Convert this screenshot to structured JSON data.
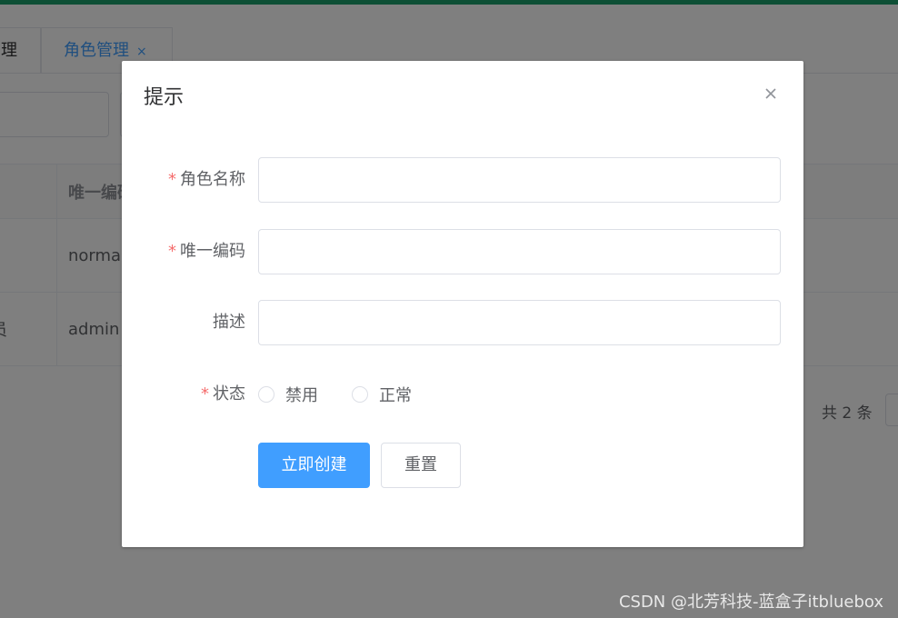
{
  "background": {
    "tabs": [
      {
        "label": "理"
      },
      {
        "label": "角色管理",
        "close": "×"
      }
    ],
    "table": {
      "header": [
        "",
        "唯一编码"
      ],
      "rows": [
        [
          "",
          "normal"
        ],
        [
          "员",
          "admin"
        ]
      ]
    },
    "pager": {
      "total": "共 2 条"
    }
  },
  "dialog": {
    "title": "提示",
    "close_icon": "close-icon",
    "fields": [
      {
        "label": "角色名称",
        "required": "*",
        "value": "",
        "placeholder": ""
      },
      {
        "label": "唯一编码",
        "required": "*",
        "value": "",
        "placeholder": ""
      },
      {
        "label": "描述",
        "required": "",
        "value": "",
        "placeholder": ""
      }
    ],
    "status": {
      "label": "状态",
      "required": "*",
      "options": [
        "禁用",
        "正常"
      ],
      "selected": ""
    },
    "buttons": {
      "submit": "立即创建",
      "reset": "重置"
    }
  },
  "colors": {
    "primary": "#409eff",
    "topbar": "#1a9e6a",
    "required": "#f56c6c"
  },
  "watermark": "CSDN @北芳科技-蓝盒子itbluebox"
}
